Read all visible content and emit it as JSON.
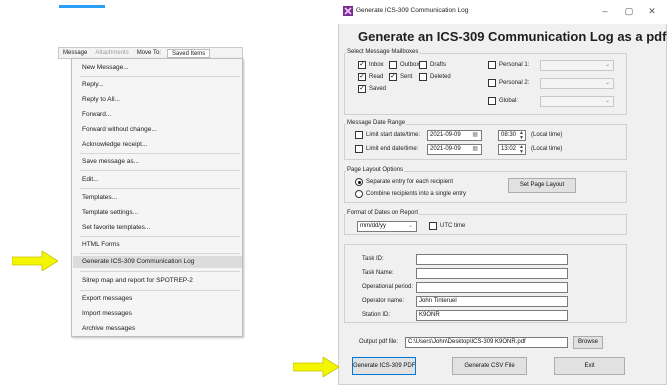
{
  "context_menu": {
    "tabs": [
      "Message",
      "Attachments",
      "Move To:",
      "Saved Items"
    ],
    "items": [
      "New Message...",
      "Reply...",
      "Reply to All...",
      "Forward...",
      "Forward without change...",
      "Acknowledge receipt...",
      "Save message as...",
      "Edit...",
      "Templates...",
      "Template settings...",
      "Set favorite templates...",
      "HTML Forms",
      "Generate ICS-309 Communication Log",
      "Sitrep map and report for SPOTREP-2",
      "Export messages",
      "Import messages",
      "Archive messages"
    ],
    "highlighted_index": 12
  },
  "dialog": {
    "window_title": "Generate ICS-309 Communication Log",
    "heading": "Generate an ICS-309 Communication Log as a pdf File",
    "mailboxes": {
      "group_label": "Select Message Mailboxes",
      "inbox": "Inbox",
      "outbox": "Outbox",
      "drafts": "Drafts",
      "read": "Read",
      "sent": "Sent",
      "deleted": "Deleted",
      "saved": "Saved",
      "personal1": "Personal 1:",
      "personal2": "Personal 2:",
      "global": "Global:"
    },
    "date_range": {
      "group_label": "Message Date Range",
      "limit_start": "Limit start date/time:",
      "limit_end": "Limit end date/time:",
      "start_date": "2021-09-09",
      "end_date": "2021-09-09",
      "start_time": "08:30",
      "end_time": "13:02",
      "local_time": "(Local time)"
    },
    "layout": {
      "group_label": "Page Layout Options",
      "separate": "Separate entry for each recipient",
      "combine": "Combine recipients into a single entry",
      "set_page_layout": "Set Page Layout"
    },
    "date_format": {
      "group_label": "Format of Dates on Report",
      "value": "mm/dd/yy",
      "utc": "UTC time"
    },
    "fields": {
      "task_id": "Task ID:",
      "task_name": "Task Name:",
      "operational_period": "Operational period:",
      "operator_name": "Operator name:",
      "operator_name_value": "John Tinteruel",
      "station_id": "Station ID:",
      "station_id_value": "K9ONR",
      "output_pdf": "Output pdf file:",
      "output_pdf_value": "C:\\Users\\John\\Desktop\\ICS-309 K9ONR.pdf",
      "browse": "Browse"
    },
    "buttons": {
      "generate_pdf": "Generate ICS-309 PDF",
      "generate_csv": "Generate CSV File",
      "exit": "Exit"
    }
  },
  "colors": {
    "arrow": "#f4f600",
    "accent_line": "#2a9df4",
    "focus_border": "#0078d7"
  }
}
